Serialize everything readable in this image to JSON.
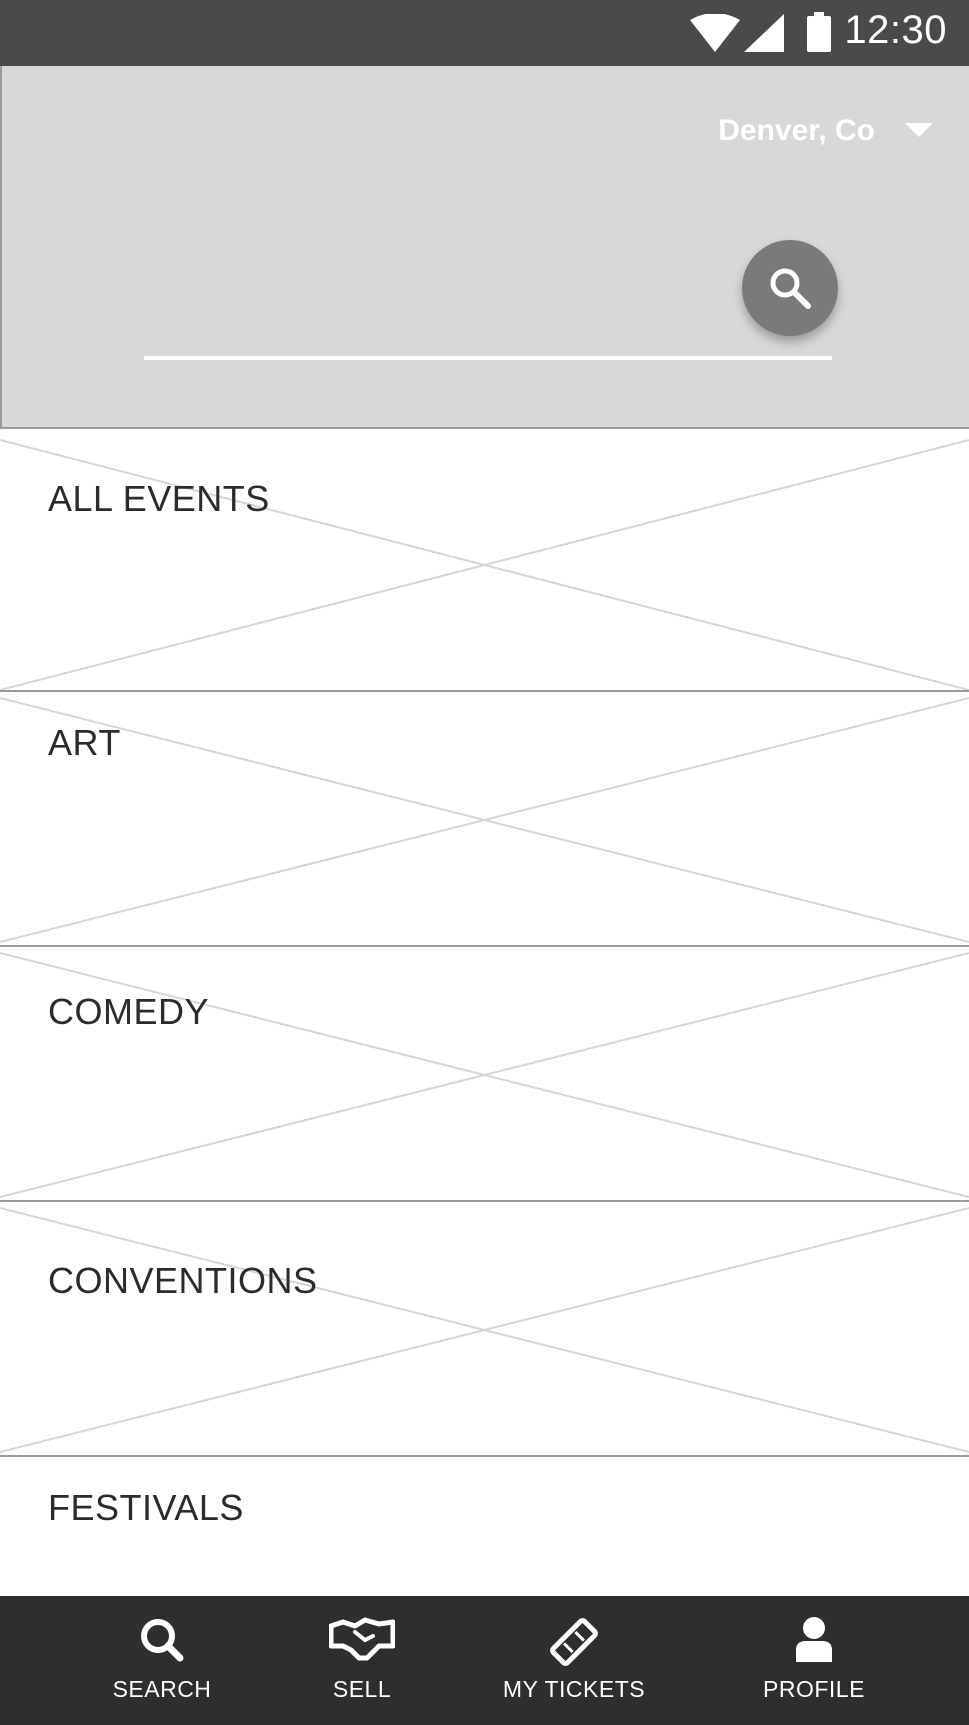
{
  "status_bar": {
    "time": "12:30",
    "icons": [
      "wifi-icon",
      "signal-icon",
      "battery-icon"
    ]
  },
  "header": {
    "location": "Denver, Co",
    "search_value": "",
    "search_icon": "search-icon"
  },
  "categories": [
    {
      "label": "ALL EVENTS"
    },
    {
      "label": "ART"
    },
    {
      "label": "COMEDY"
    },
    {
      "label": "CONVENTIONS"
    },
    {
      "label": "FESTIVALS"
    }
  ],
  "bottom_nav": {
    "items": [
      {
        "label": "SEARCH",
        "icon": "search-icon"
      },
      {
        "label": "SELL",
        "icon": "handshake-icon"
      },
      {
        "label": "MY TICKETS",
        "icon": "ticket-icon"
      },
      {
        "label": "PROFILE",
        "icon": "person-icon"
      }
    ]
  },
  "colors": {
    "status_bar": "#4a4a4a",
    "header_bg": "#d8d8d8",
    "fab": "#7a7a7a",
    "nav_bg": "#2e2e2e",
    "text_dark": "#2b2b2b"
  }
}
